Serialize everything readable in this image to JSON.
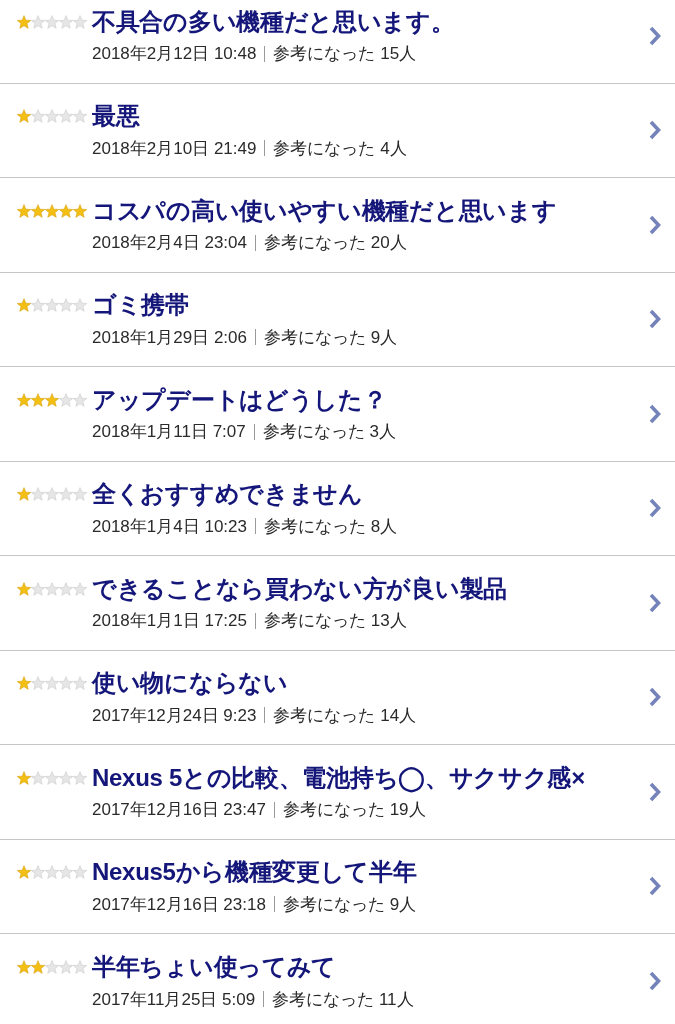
{
  "reviews": [
    {
      "stars": 1,
      "title": "不具合の多い機種だと思います。",
      "date": "2018年2月12日 10:48",
      "helpful": "参考になった 15人"
    },
    {
      "stars": 1,
      "title": "最悪",
      "date": "2018年2月10日 21:49",
      "helpful": "参考になった 4人"
    },
    {
      "stars": 5,
      "title": "コスパの高い使いやすい機種だと思います",
      "date": "2018年2月4日 23:04",
      "helpful": "参考になった 20人"
    },
    {
      "stars": 1,
      "title": "ゴミ携帯",
      "date": "2018年1月29日 2:06",
      "helpful": "参考になった 9人"
    },
    {
      "stars": 3,
      "title": "アップデートはどうした？",
      "date": "2018年1月11日 7:07",
      "helpful": "参考になった 3人"
    },
    {
      "stars": 1,
      "title": "全くおすすめできません",
      "date": "2018年1月4日 10:23",
      "helpful": "参考になった 8人"
    },
    {
      "stars": 1,
      "title": "できることなら買わない方が良い製品",
      "date": "2018年1月1日 17:25",
      "helpful": "参考になった 13人"
    },
    {
      "stars": 1,
      "title": "使い物にならない",
      "date": "2017年12月24日 9:23",
      "helpful": "参考になった 14人"
    },
    {
      "stars": 1,
      "title": "Nexus 5との比較、電池持ち◯、サクサク感×",
      "date": "2017年12月16日 23:47",
      "helpful": "参考になった 19人"
    },
    {
      "stars": 1,
      "title": "Nexus5から機種変更して半年",
      "date": "2017年12月16日 23:18",
      "helpful": "参考になった 9人"
    },
    {
      "stars": 2,
      "title": "半年ちょい使ってみて",
      "date": "2017年11月25日 5:09",
      "helpful": "参考になった 11人"
    }
  ]
}
